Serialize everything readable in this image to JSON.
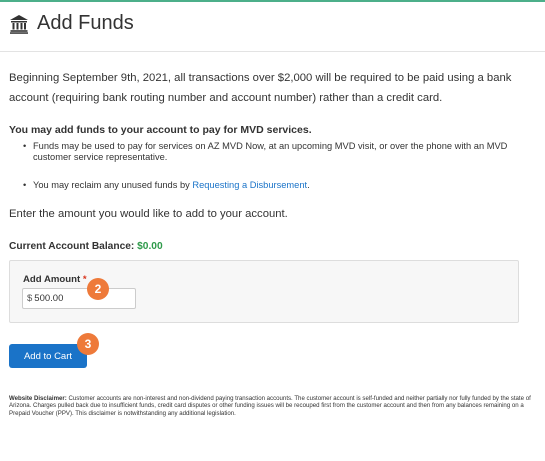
{
  "header": {
    "title": "Add Funds",
    "icon": "bank-icon"
  },
  "notice": "Beginning September 9th, 2021, all transactions over $2,000 will be required to be paid using a bank account (requiring bank routing number and account number) rather than a credit card.",
  "funds_info": {
    "heading": "You may add funds to your account to pay for MVD services.",
    "bullet1": "Funds may be used to pay for services on AZ MVD Now, at an upcoming MVD visit, or over the phone with an MVD customer service representative.",
    "bullet2_prefix": "You may reclaim any unused funds by ",
    "bullet2_link": "Requesting a Disbursement",
    "bullet2_suffix": "."
  },
  "enter_prompt": "Enter the amount you would like to add to your account.",
  "balance": {
    "label": "Current Account Balance:",
    "value": "$0.00"
  },
  "amount_field": {
    "label": "Add Amount",
    "required_mark": "*",
    "currency": "$",
    "value": "500.00"
  },
  "add_to_cart_label": "Add to Cart",
  "badges": {
    "step2": "2",
    "step3": "3"
  },
  "disclaimer": {
    "label": "Website Disclaimer:",
    "text": " Customer accounts are non-interest and non-dividend paying transaction accounts. The customer account is self-funded and neither partially nor fully funded by the state of Arizona. Charges pulled back due to insufficient funds, credit card disputes or other funding issues will be recouped first from the customer account and then from any balances remaining on a Prepaid Voucher (PPV). This disclaimer is notwithstanding any additional legislation."
  },
  "colors": {
    "accent": "#1a73c8",
    "badge": "#ee7a3a",
    "balance_value": "#2e9a4a",
    "required": "#d9341c"
  }
}
